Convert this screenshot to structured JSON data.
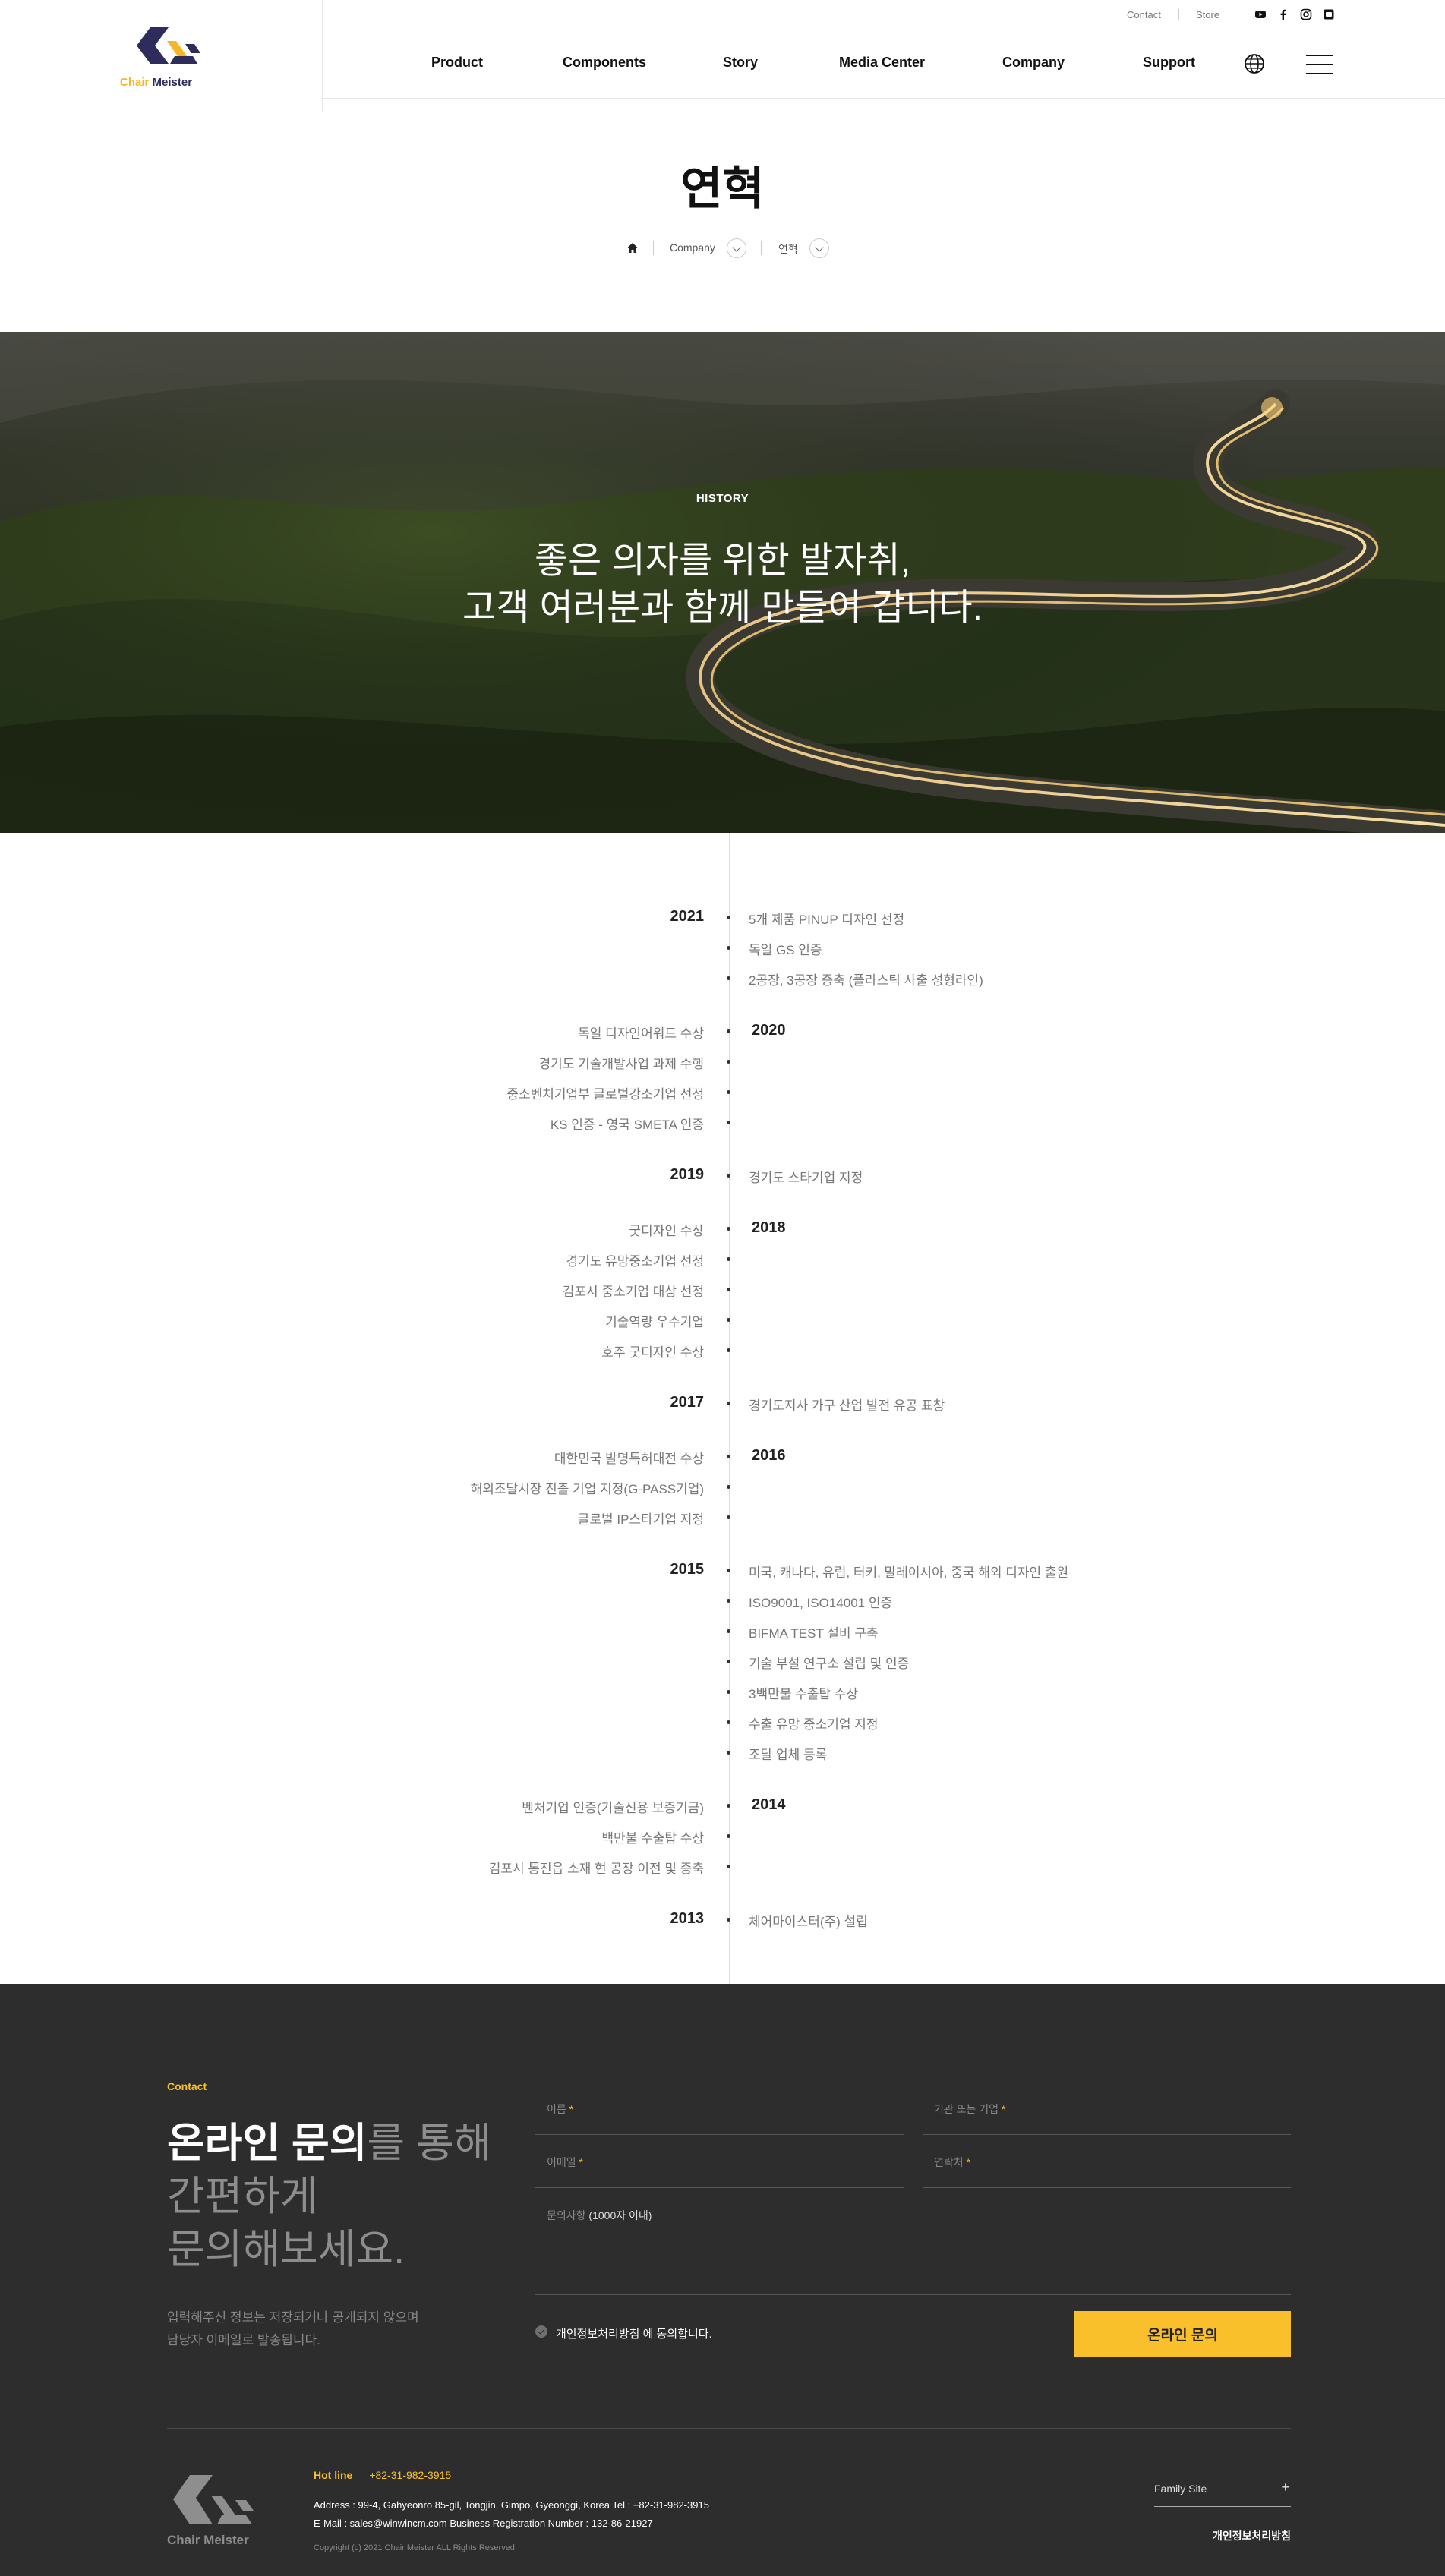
{
  "brand": {
    "logo_word1": "Chair",
    "logo_word2": "Meister",
    "accent_color": "#f9c02c",
    "navy_color": "#2d2c5b"
  },
  "util_nav": {
    "contact": "Contact",
    "store": "Store"
  },
  "sns_icons": [
    "youtube-icon",
    "facebook-icon",
    "instagram-icon",
    "blog-icon"
  ],
  "gnb": [
    "Product",
    "Components",
    "Story",
    "Media Center",
    "Company",
    "Support"
  ],
  "gnb_active": "Company",
  "page": {
    "title": "연혁",
    "breadcrumb": {
      "level1": "Company",
      "level2": "연혁"
    }
  },
  "hero": {
    "tag": "HISTORY",
    "line1": "좋은 의자를 위한 발자취,",
    "line2": "고객 여러분과 함께 만들어 갑니다."
  },
  "timeline": [
    {
      "year": "2021",
      "side": "left-year",
      "items": [
        "5개 제품 PINUP 디자인 선정",
        "독일 GS 인증",
        "2공장, 3공장 증축 (플라스틱 사출 성형라인)"
      ]
    },
    {
      "year": "2020",
      "side": "right-year",
      "items": [
        "독일 디자인어워드 수상",
        "경기도 기술개발사업 과제 수행",
        "중소벤처기업부 글로벌강소기업 선정",
        "KS 인증 - 영국 SMETA 인증"
      ]
    },
    {
      "year": "2019",
      "side": "left-year",
      "items": [
        "경기도 스타기업 지정"
      ]
    },
    {
      "year": "2018",
      "side": "right-year",
      "items": [
        "굿디자인 수상",
        "경기도 유망중소기업 선정",
        "김포시 중소기업 대상 선정",
        "기술역량 우수기업",
        "호주 굿디자인 수상"
      ]
    },
    {
      "year": "2017",
      "side": "left-year",
      "items": [
        "경기도지사 가구 산업 발전 유공 표창"
      ]
    },
    {
      "year": "2016",
      "side": "right-year",
      "items": [
        "대한민국 발명특허대전 수상",
        "해외조달시장 진출 기업 지정(G-PASS기업)",
        "글로벌 IP스타기업 지정"
      ]
    },
    {
      "year": "2015",
      "side": "left-year",
      "items": [
        "미국, 캐나다, 유럽, 터키, 말레이시아, 중국 해외 디자인 출원",
        "ISO9001, ISO14001 인증",
        "BIFMA TEST 설비 구축",
        "기술 부설 연구소 설립 및 인증",
        "3백만불 수출탑 수상",
        "수출 유망 중소기업 지정",
        "조달 업체 등록"
      ]
    },
    {
      "year": "2014",
      "side": "right-year",
      "items": [
        "벤처기업 인증(기술신용 보증기금)",
        "백만불 수출탑 수상",
        "김포시 통진읍 소재 현 공장 이전 및 증축"
      ]
    },
    {
      "year": "2013",
      "side": "left-year",
      "items": [
        "체어마이스터(주) 설립"
      ]
    }
  ],
  "contact": {
    "tag": "Contact",
    "head_bold": "온라인 문의",
    "head_rest1": "를 통해",
    "head_line2": "간편하게",
    "head_line3": "문의해보세요.",
    "desc1": "입력해주신 정보는 저장되거나 공개되지 않으며",
    "desc2": "담당자 이메일로 발송됩니다.",
    "fields": {
      "name": "이름",
      "company": "기관 또는 기업",
      "email": "이메일",
      "phone": "연락처"
    },
    "required_mark": "*",
    "message_label": "문의사항",
    "message_limit": "(1000자 이내)",
    "agree_link": "개인정보처리방침",
    "agree_rest": " 에 동의합니다.",
    "submit": "온라인 문의"
  },
  "footer": {
    "logo_text": "Chair Meister",
    "hotline_label": "Hot line",
    "hotline_value": "+82-31-982-3915",
    "address_line": "Address : 99-4, Gahyeonro 85-gil, Tongjin, Gimpo, Gyeonggi, Korea      Tel : +82-31-982-3915",
    "email_line": "E-Mail : sales@winwincm.com      Business Registration Number : 132-86-21927",
    "copyright": "Copyright (c) 2021 Chair Meister ALL Rights Reserved.",
    "family_site": "Family Site",
    "privacy": "개인정보처리방침"
  }
}
